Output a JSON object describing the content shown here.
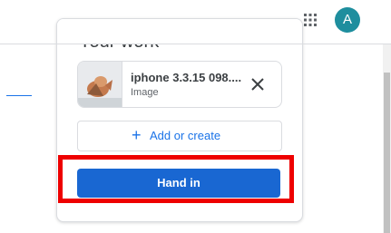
{
  "topbar": {
    "apps_icon": "apps-grid-icon",
    "avatar_letter": "A",
    "avatar_color": "#1e8e9e"
  },
  "card": {
    "title": "Your work",
    "attachment": {
      "name": "iphone 3.3.15 098....",
      "type": "Image",
      "remove_icon": "close-icon"
    },
    "add_label": "Add or create",
    "add_icon": "plus-icon",
    "hand_in_label": "Hand in"
  },
  "colors": {
    "primary_button": "#1967d2",
    "link_blue": "#1a73e8",
    "highlight": "#ee0000"
  }
}
